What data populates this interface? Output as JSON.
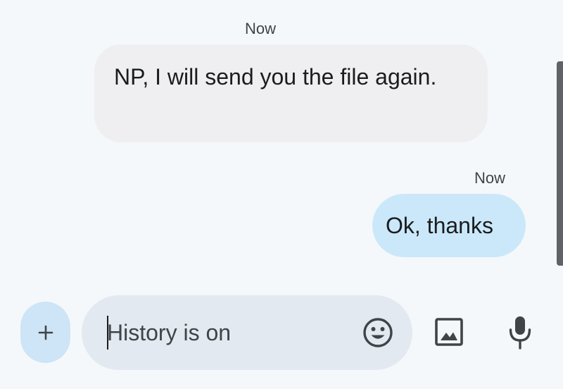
{
  "messages": [
    {
      "direction": "received",
      "timestamp": "Now",
      "text": "NP, I will send you the file again."
    },
    {
      "direction": "sent",
      "timestamp": "Now",
      "text": "Ok, thanks"
    }
  ],
  "compose": {
    "placeholder": "History is on",
    "value": ""
  },
  "icons": {
    "add": "plus-icon",
    "emoji": "emoji-icon",
    "image": "image-icon",
    "mic": "microphone-icon"
  },
  "colors": {
    "background": "#f5f8fb",
    "received_bubble": "#efeff1",
    "sent_bubble": "#cbe8fb",
    "compose_field": "#e3e9f1",
    "add_button": "#cde5f6",
    "icon": "#3f4446"
  }
}
